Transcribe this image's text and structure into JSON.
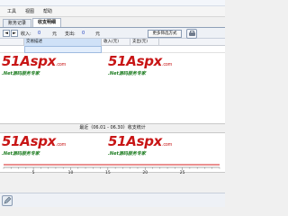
{
  "menu": {
    "items": [
      "工具",
      "视图",
      "帮助"
    ]
  },
  "tabs": [
    {
      "label": "账务记录",
      "active": false
    },
    {
      "label": "收支明细",
      "active": true
    }
  ],
  "filter": {
    "prev_arrow": "◄",
    "next_arrow": "►",
    "income_label": "收入:",
    "income_value": "0",
    "income_unit": "元",
    "expense_label": "支出:",
    "expense_value": "0",
    "expense_unit": "元",
    "more_button": "更多筛选方式"
  },
  "grid": {
    "columns": [
      "",
      "交易描述",
      "收入(元)",
      "支出(元)"
    ]
  },
  "watermark": {
    "brand": "51Aspx",
    "domain": ".com",
    "subtitle": ".Net源码服务专家"
  },
  "chart_data": {
    "type": "line",
    "title": "最近（06.01 - 06.30）收支统计",
    "x": [
      1,
      5,
      10,
      15,
      20,
      25,
      30
    ],
    "x_ticks": [
      5,
      10,
      15,
      20,
      25
    ],
    "xlim": [
      1,
      30
    ],
    "series": [
      {
        "values": [
          0,
          0,
          0,
          0,
          0,
          0,
          0
        ],
        "color": "#d42020"
      }
    ],
    "colors": {
      "series": "#d42020",
      "axis": "#555555"
    }
  }
}
